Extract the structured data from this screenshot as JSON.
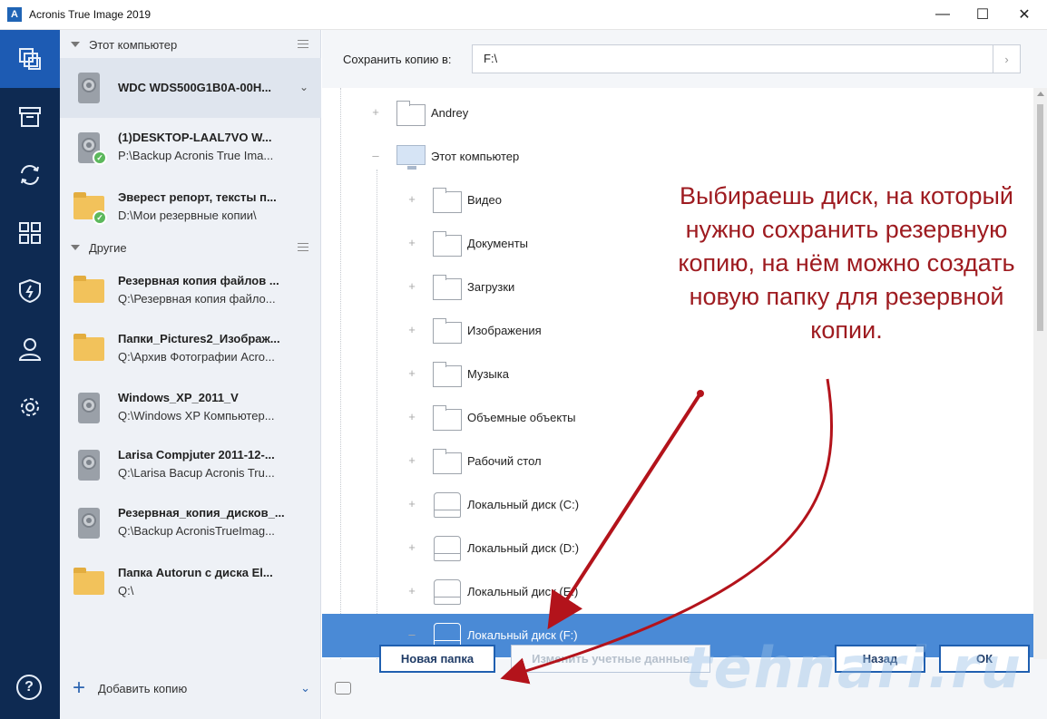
{
  "window": {
    "title": "Acronis True Image 2019",
    "logo_letter": "A",
    "minimize": "—",
    "maximize": "☐",
    "close": "✕"
  },
  "nav": {
    "items": [
      "backup-icon",
      "archive-icon",
      "sync-icon",
      "tools-icon",
      "protection-icon",
      "account-icon",
      "settings-icon"
    ],
    "help": "?"
  },
  "panel": {
    "section_this_pc": "Этот компьютер",
    "section_other": "Другие",
    "items": [
      {
        "name": "WDC WDS500G1B0A-00H...",
        "path": "",
        "icon": "hdd",
        "check": false
      },
      {
        "name": "(1)DESKTOP-LAAL7VO W...",
        "path": "P:\\Backup Acronis True Ima...",
        "icon": "hdd",
        "check": true
      },
      {
        "name": "Эверест репорт, тексты п...",
        "path": "D:\\Мои резервные копии\\",
        "icon": "folder",
        "check": true
      },
      {
        "name": "Резервная копия файлов ...",
        "path": "Q:\\Резервная копия файло...",
        "icon": "folder",
        "check": false
      },
      {
        "name": "Папки_Pictures2_Изображ...",
        "path": "Q:\\Архив Фотографии Acro...",
        "icon": "folder",
        "check": false
      },
      {
        "name": "Windows_XP_2011_V",
        "path": "Q:\\Windows XP Компьютер...",
        "icon": "hdd",
        "check": false
      },
      {
        "name": "Larisa Compjuter 2011-12-...",
        "path": "Q:\\Larisa Bacup Acronis Tru...",
        "icon": "hdd",
        "check": false
      },
      {
        "name": "Резервная_копия_дисков_...",
        "path": "Q:\\Backup AcronisTrueImag...",
        "icon": "hdd",
        "check": false
      },
      {
        "name": " Папка Autorun с диска El...",
        "path": "Q:\\",
        "icon": "folder",
        "check": false
      }
    ],
    "add_copy": "Добавить копию"
  },
  "main": {
    "save_label": "Сохранить копию в:",
    "save_value": "F:\\",
    "tree": [
      {
        "label": "Andrey",
        "icon": "folder",
        "level": 0,
        "sign": "+"
      },
      {
        "label": "Этот компьютер",
        "icon": "monitor",
        "level": 0,
        "sign": "–"
      },
      {
        "label": "Видео",
        "icon": "folder",
        "level": 1,
        "sign": "+"
      },
      {
        "label": "Документы",
        "icon": "folder",
        "level": 1,
        "sign": "+"
      },
      {
        "label": "Загрузки",
        "icon": "folder",
        "level": 1,
        "sign": "+"
      },
      {
        "label": "Изображения",
        "icon": "folder",
        "level": 1,
        "sign": "+"
      },
      {
        "label": "Музыка",
        "icon": "folder",
        "level": 1,
        "sign": "+"
      },
      {
        "label": "Объемные объекты",
        "icon": "folder",
        "level": 1,
        "sign": "+"
      },
      {
        "label": "Рабочий стол",
        "icon": "folder",
        "level": 1,
        "sign": "+"
      },
      {
        "label": "Локальный диск (C:)",
        "icon": "disk",
        "level": 1,
        "sign": "+"
      },
      {
        "label": "Локальный диск (D:)",
        "icon": "disk",
        "level": 1,
        "sign": "+"
      },
      {
        "label": "Локальный диск (E:)",
        "icon": "disk",
        "level": 1,
        "sign": "+"
      },
      {
        "label": "Локальный диск (F:)",
        "icon": "disk",
        "level": 1,
        "sign": "–",
        "selected": true
      }
    ],
    "buttons": {
      "new_folder": "Новая папка",
      "change_credentials": "Изменить учетные данные",
      "back": "Назад",
      "ok": "ОК"
    }
  },
  "annotation": "Выбираешь диск, на который нужно сохранить резервную копию, на нём можно создать новую папку для резервной копии.",
  "watermark": "tehnari.ru",
  "colors": {
    "nav_bg": "#0e2a52",
    "nav_active": "#1d5bb3",
    "selected_row": "#4a8ad6",
    "annotation": "#9e1b20",
    "button_border": "#1f5fb0"
  }
}
